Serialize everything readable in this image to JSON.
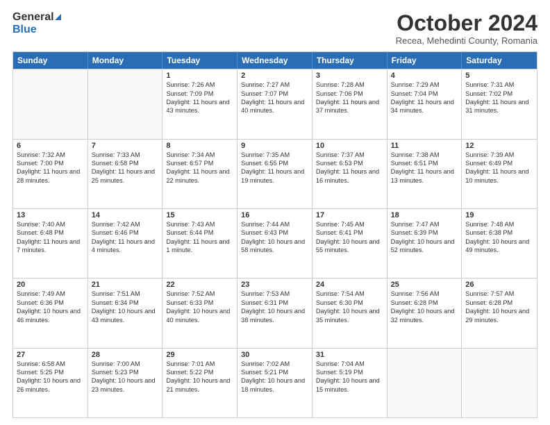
{
  "logo": {
    "line1": "General",
    "line2": "Blue"
  },
  "header": {
    "month": "October 2024",
    "location": "Recea, Mehedinti County, Romania"
  },
  "weekdays": [
    "Sunday",
    "Monday",
    "Tuesday",
    "Wednesday",
    "Thursday",
    "Friday",
    "Saturday"
  ],
  "weeks": [
    [
      {
        "day": "",
        "sunrise": "",
        "sunset": "",
        "daylight": ""
      },
      {
        "day": "",
        "sunrise": "",
        "sunset": "",
        "daylight": ""
      },
      {
        "day": "1",
        "sunrise": "Sunrise: 7:26 AM",
        "sunset": "Sunset: 7:09 PM",
        "daylight": "Daylight: 11 hours and 43 minutes."
      },
      {
        "day": "2",
        "sunrise": "Sunrise: 7:27 AM",
        "sunset": "Sunset: 7:07 PM",
        "daylight": "Daylight: 11 hours and 40 minutes."
      },
      {
        "day": "3",
        "sunrise": "Sunrise: 7:28 AM",
        "sunset": "Sunset: 7:06 PM",
        "daylight": "Daylight: 11 hours and 37 minutes."
      },
      {
        "day": "4",
        "sunrise": "Sunrise: 7:29 AM",
        "sunset": "Sunset: 7:04 PM",
        "daylight": "Daylight: 11 hours and 34 minutes."
      },
      {
        "day": "5",
        "sunrise": "Sunrise: 7:31 AM",
        "sunset": "Sunset: 7:02 PM",
        "daylight": "Daylight: 11 hours and 31 minutes."
      }
    ],
    [
      {
        "day": "6",
        "sunrise": "Sunrise: 7:32 AM",
        "sunset": "Sunset: 7:00 PM",
        "daylight": "Daylight: 11 hours and 28 minutes."
      },
      {
        "day": "7",
        "sunrise": "Sunrise: 7:33 AM",
        "sunset": "Sunset: 6:58 PM",
        "daylight": "Daylight: 11 hours and 25 minutes."
      },
      {
        "day": "8",
        "sunrise": "Sunrise: 7:34 AM",
        "sunset": "Sunset: 6:57 PM",
        "daylight": "Daylight: 11 hours and 22 minutes."
      },
      {
        "day": "9",
        "sunrise": "Sunrise: 7:35 AM",
        "sunset": "Sunset: 6:55 PM",
        "daylight": "Daylight: 11 hours and 19 minutes."
      },
      {
        "day": "10",
        "sunrise": "Sunrise: 7:37 AM",
        "sunset": "Sunset: 6:53 PM",
        "daylight": "Daylight: 11 hours and 16 minutes."
      },
      {
        "day": "11",
        "sunrise": "Sunrise: 7:38 AM",
        "sunset": "Sunset: 6:51 PM",
        "daylight": "Daylight: 11 hours and 13 minutes."
      },
      {
        "day": "12",
        "sunrise": "Sunrise: 7:39 AM",
        "sunset": "Sunset: 6:49 PM",
        "daylight": "Daylight: 11 hours and 10 minutes."
      }
    ],
    [
      {
        "day": "13",
        "sunrise": "Sunrise: 7:40 AM",
        "sunset": "Sunset: 6:48 PM",
        "daylight": "Daylight: 11 hours and 7 minutes."
      },
      {
        "day": "14",
        "sunrise": "Sunrise: 7:42 AM",
        "sunset": "Sunset: 6:46 PM",
        "daylight": "Daylight: 11 hours and 4 minutes."
      },
      {
        "day": "15",
        "sunrise": "Sunrise: 7:43 AM",
        "sunset": "Sunset: 6:44 PM",
        "daylight": "Daylight: 11 hours and 1 minute."
      },
      {
        "day": "16",
        "sunrise": "Sunrise: 7:44 AM",
        "sunset": "Sunset: 6:43 PM",
        "daylight": "Daylight: 10 hours and 58 minutes."
      },
      {
        "day": "17",
        "sunrise": "Sunrise: 7:45 AM",
        "sunset": "Sunset: 6:41 PM",
        "daylight": "Daylight: 10 hours and 55 minutes."
      },
      {
        "day": "18",
        "sunrise": "Sunrise: 7:47 AM",
        "sunset": "Sunset: 6:39 PM",
        "daylight": "Daylight: 10 hours and 52 minutes."
      },
      {
        "day": "19",
        "sunrise": "Sunrise: 7:48 AM",
        "sunset": "Sunset: 6:38 PM",
        "daylight": "Daylight: 10 hours and 49 minutes."
      }
    ],
    [
      {
        "day": "20",
        "sunrise": "Sunrise: 7:49 AM",
        "sunset": "Sunset: 6:36 PM",
        "daylight": "Daylight: 10 hours and 46 minutes."
      },
      {
        "day": "21",
        "sunrise": "Sunrise: 7:51 AM",
        "sunset": "Sunset: 6:34 PM",
        "daylight": "Daylight: 10 hours and 43 minutes."
      },
      {
        "day": "22",
        "sunrise": "Sunrise: 7:52 AM",
        "sunset": "Sunset: 6:33 PM",
        "daylight": "Daylight: 10 hours and 40 minutes."
      },
      {
        "day": "23",
        "sunrise": "Sunrise: 7:53 AM",
        "sunset": "Sunset: 6:31 PM",
        "daylight": "Daylight: 10 hours and 38 minutes."
      },
      {
        "day": "24",
        "sunrise": "Sunrise: 7:54 AM",
        "sunset": "Sunset: 6:30 PM",
        "daylight": "Daylight: 10 hours and 35 minutes."
      },
      {
        "day": "25",
        "sunrise": "Sunrise: 7:56 AM",
        "sunset": "Sunset: 6:28 PM",
        "daylight": "Daylight: 10 hours and 32 minutes."
      },
      {
        "day": "26",
        "sunrise": "Sunrise: 7:57 AM",
        "sunset": "Sunset: 6:28 PM",
        "daylight": "Daylight: 10 hours and 29 minutes."
      }
    ],
    [
      {
        "day": "27",
        "sunrise": "Sunrise: 6:58 AM",
        "sunset": "Sunset: 5:25 PM",
        "daylight": "Daylight: 10 hours and 26 minutes."
      },
      {
        "day": "28",
        "sunrise": "Sunrise: 7:00 AM",
        "sunset": "Sunset: 5:23 PM",
        "daylight": "Daylight: 10 hours and 23 minutes."
      },
      {
        "day": "29",
        "sunrise": "Sunrise: 7:01 AM",
        "sunset": "Sunset: 5:22 PM",
        "daylight": "Daylight: 10 hours and 21 minutes."
      },
      {
        "day": "30",
        "sunrise": "Sunrise: 7:02 AM",
        "sunset": "Sunset: 5:21 PM",
        "daylight": "Daylight: 10 hours and 18 minutes."
      },
      {
        "day": "31",
        "sunrise": "Sunrise: 7:04 AM",
        "sunset": "Sunset: 5:19 PM",
        "daylight": "Daylight: 10 hours and 15 minutes."
      },
      {
        "day": "",
        "sunrise": "",
        "sunset": "",
        "daylight": ""
      },
      {
        "day": "",
        "sunrise": "",
        "sunset": "",
        "daylight": ""
      }
    ]
  ]
}
